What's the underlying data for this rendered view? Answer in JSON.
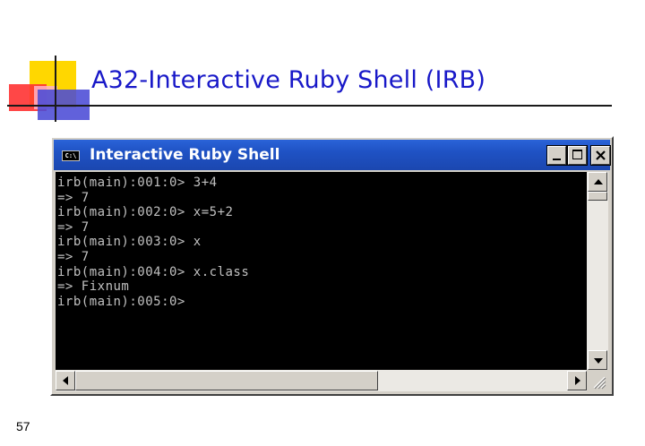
{
  "slide": {
    "title": "A32-Interactive Ruby Shell (IRB)",
    "page_number": "57"
  },
  "window": {
    "title": "Interactive Ruby Shell",
    "icon_label": "C:\\",
    "controls": [
      "minimize-icon",
      "maximize-icon",
      "close-icon"
    ]
  },
  "console": {
    "lines": [
      "irb(main):001:0> 3+4",
      "=> 7",
      "irb(main):002:0> x=5+2",
      "=> 7",
      "irb(main):003:0> x",
      "=> 7",
      "irb(main):004:0> x.class",
      "=> Fixnum",
      "irb(main):005:0>"
    ]
  },
  "colors": {
    "title_text": "#1818c8",
    "titlebar": "#1f52c4",
    "console_bg": "#000000",
    "console_fg": "#c0c0c0",
    "window_frame": "#d4d0c8"
  }
}
